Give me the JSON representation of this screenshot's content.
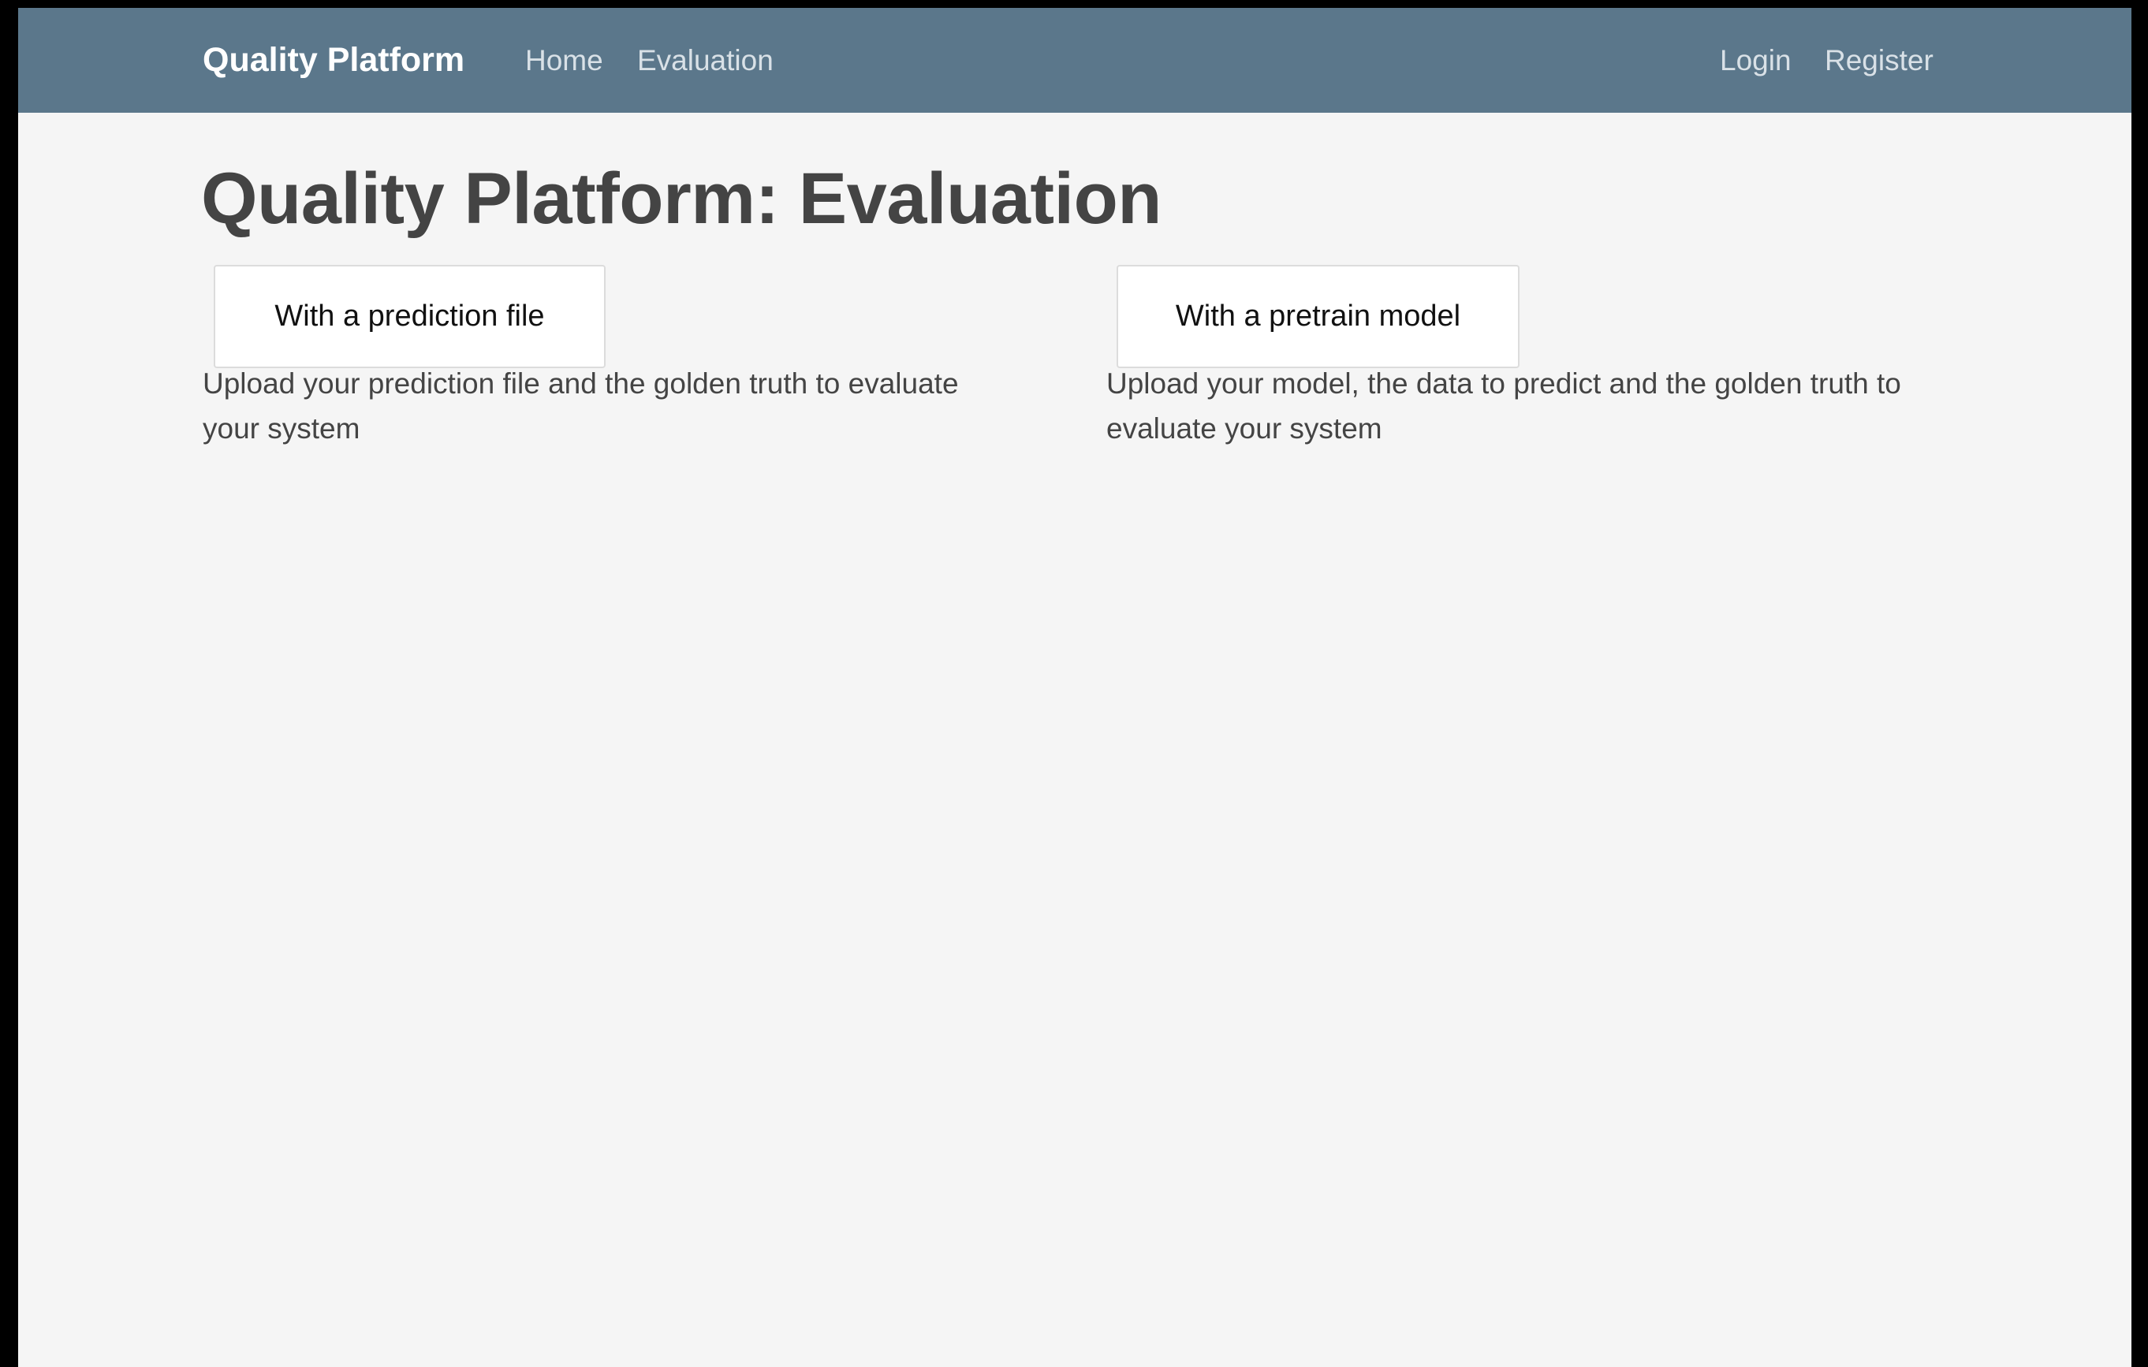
{
  "navbar": {
    "brand": "Quality Platform",
    "links": {
      "home": "Home",
      "evaluation": "Evaluation"
    },
    "auth": {
      "login": "Login",
      "register": "Register"
    },
    "background_color": "#5b778b"
  },
  "main": {
    "title": "Quality Platform: Evaluation",
    "options": [
      {
        "button_label": "With a prediction file",
        "description": "Upload your prediction file and the golden truth to evaluate your system"
      },
      {
        "button_label": "With a pretrain model",
        "description": "Upload your model, the data to predict and the golden truth to evaluate your system"
      }
    ]
  },
  "colors": {
    "page_background": "#f5f5f5",
    "text": "#444444",
    "button_background": "#ffffff"
  }
}
